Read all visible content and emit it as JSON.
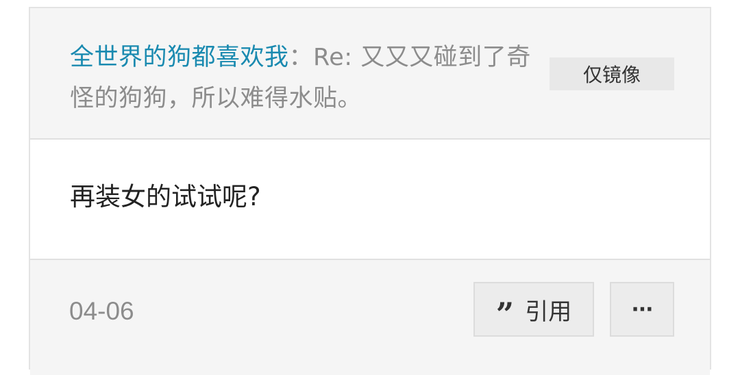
{
  "post": {
    "author": "全世界的狗都喜欢我",
    "separator": "：",
    "title": "Re: 又又又碰到了奇怪的狗狗，所以难得水贴。",
    "mirror_label": "仅镜像",
    "content": "再装女的试试呢?",
    "date": "04-06",
    "quote_label": "引用",
    "more_label": "···"
  },
  "colors": {
    "author": "#1a8ab0",
    "muted_text": "#8c8c8c",
    "panel_bg": "#f5f5f5"
  },
  "icons": {
    "quote": "quote-icon"
  }
}
